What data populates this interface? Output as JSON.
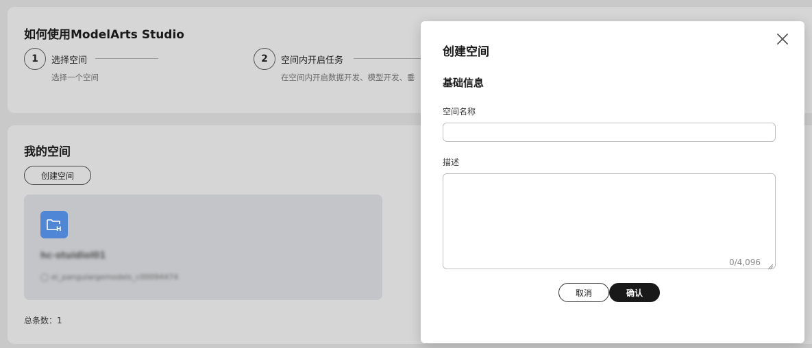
{
  "guide": {
    "title": "如何使用ModelArts Studio",
    "steps": [
      {
        "number": "1",
        "title": "选择空间",
        "desc": "选择一个空间"
      },
      {
        "number": "2",
        "title": "空间内开启任务",
        "desc": "在空间内开启数据开发、模型开发、垂"
      }
    ]
  },
  "spaces": {
    "title": "我的空间",
    "create_label": "创建空间",
    "tile": {
      "icon": "folder-h-icon",
      "name": "hc-stuidiol01",
      "meta": "ei_pangulargemodels_c00094474"
    },
    "total_label": "总条数：1"
  },
  "modal": {
    "title": "创建空间",
    "section": "基础信息",
    "name_label": "空间名称",
    "name_value": "",
    "desc_label": "描述",
    "desc_value": "",
    "char_count": "0/4,096",
    "cancel_label": "取消",
    "confirm_label": "确认"
  },
  "colors": {
    "overlay_bg": "#c9c9c9",
    "card_bg": "#d6d6d6",
    "icon_blue": "#4f87d6",
    "primary_button": "#191919"
  }
}
